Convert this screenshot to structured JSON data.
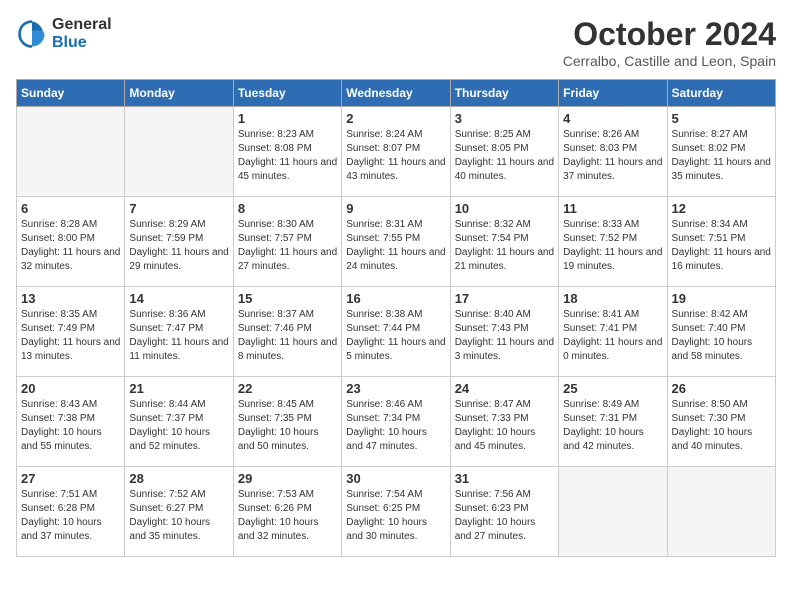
{
  "header": {
    "logo_general": "General",
    "logo_blue": "Blue",
    "month": "October 2024",
    "location": "Cerralbo, Castille and Leon, Spain"
  },
  "days_of_week": [
    "Sunday",
    "Monday",
    "Tuesday",
    "Wednesday",
    "Thursday",
    "Friday",
    "Saturday"
  ],
  "weeks": [
    [
      {
        "day": "",
        "empty": true
      },
      {
        "day": "",
        "empty": true
      },
      {
        "day": "1",
        "sunrise": "Sunrise: 8:23 AM",
        "sunset": "Sunset: 8:08 PM",
        "daylight": "Daylight: 11 hours and 45 minutes."
      },
      {
        "day": "2",
        "sunrise": "Sunrise: 8:24 AM",
        "sunset": "Sunset: 8:07 PM",
        "daylight": "Daylight: 11 hours and 43 minutes."
      },
      {
        "day": "3",
        "sunrise": "Sunrise: 8:25 AM",
        "sunset": "Sunset: 8:05 PM",
        "daylight": "Daylight: 11 hours and 40 minutes."
      },
      {
        "day": "4",
        "sunrise": "Sunrise: 8:26 AM",
        "sunset": "Sunset: 8:03 PM",
        "daylight": "Daylight: 11 hours and 37 minutes."
      },
      {
        "day": "5",
        "sunrise": "Sunrise: 8:27 AM",
        "sunset": "Sunset: 8:02 PM",
        "daylight": "Daylight: 11 hours and 35 minutes."
      }
    ],
    [
      {
        "day": "6",
        "sunrise": "Sunrise: 8:28 AM",
        "sunset": "Sunset: 8:00 PM",
        "daylight": "Daylight: 11 hours and 32 minutes."
      },
      {
        "day": "7",
        "sunrise": "Sunrise: 8:29 AM",
        "sunset": "Sunset: 7:59 PM",
        "daylight": "Daylight: 11 hours and 29 minutes."
      },
      {
        "day": "8",
        "sunrise": "Sunrise: 8:30 AM",
        "sunset": "Sunset: 7:57 PM",
        "daylight": "Daylight: 11 hours and 27 minutes."
      },
      {
        "day": "9",
        "sunrise": "Sunrise: 8:31 AM",
        "sunset": "Sunset: 7:55 PM",
        "daylight": "Daylight: 11 hours and 24 minutes."
      },
      {
        "day": "10",
        "sunrise": "Sunrise: 8:32 AM",
        "sunset": "Sunset: 7:54 PM",
        "daylight": "Daylight: 11 hours and 21 minutes."
      },
      {
        "day": "11",
        "sunrise": "Sunrise: 8:33 AM",
        "sunset": "Sunset: 7:52 PM",
        "daylight": "Daylight: 11 hours and 19 minutes."
      },
      {
        "day": "12",
        "sunrise": "Sunrise: 8:34 AM",
        "sunset": "Sunset: 7:51 PM",
        "daylight": "Daylight: 11 hours and 16 minutes."
      }
    ],
    [
      {
        "day": "13",
        "sunrise": "Sunrise: 8:35 AM",
        "sunset": "Sunset: 7:49 PM",
        "daylight": "Daylight: 11 hours and 13 minutes."
      },
      {
        "day": "14",
        "sunrise": "Sunrise: 8:36 AM",
        "sunset": "Sunset: 7:47 PM",
        "daylight": "Daylight: 11 hours and 11 minutes."
      },
      {
        "day": "15",
        "sunrise": "Sunrise: 8:37 AM",
        "sunset": "Sunset: 7:46 PM",
        "daylight": "Daylight: 11 hours and 8 minutes."
      },
      {
        "day": "16",
        "sunrise": "Sunrise: 8:38 AM",
        "sunset": "Sunset: 7:44 PM",
        "daylight": "Daylight: 11 hours and 5 minutes."
      },
      {
        "day": "17",
        "sunrise": "Sunrise: 8:40 AM",
        "sunset": "Sunset: 7:43 PM",
        "daylight": "Daylight: 11 hours and 3 minutes."
      },
      {
        "day": "18",
        "sunrise": "Sunrise: 8:41 AM",
        "sunset": "Sunset: 7:41 PM",
        "daylight": "Daylight: 11 hours and 0 minutes."
      },
      {
        "day": "19",
        "sunrise": "Sunrise: 8:42 AM",
        "sunset": "Sunset: 7:40 PM",
        "daylight": "Daylight: 10 hours and 58 minutes."
      }
    ],
    [
      {
        "day": "20",
        "sunrise": "Sunrise: 8:43 AM",
        "sunset": "Sunset: 7:38 PM",
        "daylight": "Daylight: 10 hours and 55 minutes."
      },
      {
        "day": "21",
        "sunrise": "Sunrise: 8:44 AM",
        "sunset": "Sunset: 7:37 PM",
        "daylight": "Daylight: 10 hours and 52 minutes."
      },
      {
        "day": "22",
        "sunrise": "Sunrise: 8:45 AM",
        "sunset": "Sunset: 7:35 PM",
        "daylight": "Daylight: 10 hours and 50 minutes."
      },
      {
        "day": "23",
        "sunrise": "Sunrise: 8:46 AM",
        "sunset": "Sunset: 7:34 PM",
        "daylight": "Daylight: 10 hours and 47 minutes."
      },
      {
        "day": "24",
        "sunrise": "Sunrise: 8:47 AM",
        "sunset": "Sunset: 7:33 PM",
        "daylight": "Daylight: 10 hours and 45 minutes."
      },
      {
        "day": "25",
        "sunrise": "Sunrise: 8:49 AM",
        "sunset": "Sunset: 7:31 PM",
        "daylight": "Daylight: 10 hours and 42 minutes."
      },
      {
        "day": "26",
        "sunrise": "Sunrise: 8:50 AM",
        "sunset": "Sunset: 7:30 PM",
        "daylight": "Daylight: 10 hours and 40 minutes."
      }
    ],
    [
      {
        "day": "27",
        "sunrise": "Sunrise: 7:51 AM",
        "sunset": "Sunset: 6:28 PM",
        "daylight": "Daylight: 10 hours and 37 minutes."
      },
      {
        "day": "28",
        "sunrise": "Sunrise: 7:52 AM",
        "sunset": "Sunset: 6:27 PM",
        "daylight": "Daylight: 10 hours and 35 minutes."
      },
      {
        "day": "29",
        "sunrise": "Sunrise: 7:53 AM",
        "sunset": "Sunset: 6:26 PM",
        "daylight": "Daylight: 10 hours and 32 minutes."
      },
      {
        "day": "30",
        "sunrise": "Sunrise: 7:54 AM",
        "sunset": "Sunset: 6:25 PM",
        "daylight": "Daylight: 10 hours and 30 minutes."
      },
      {
        "day": "31",
        "sunrise": "Sunrise: 7:56 AM",
        "sunset": "Sunset: 6:23 PM",
        "daylight": "Daylight: 10 hours and 27 minutes."
      },
      {
        "day": "",
        "empty": true
      },
      {
        "day": "",
        "empty": true
      }
    ]
  ]
}
